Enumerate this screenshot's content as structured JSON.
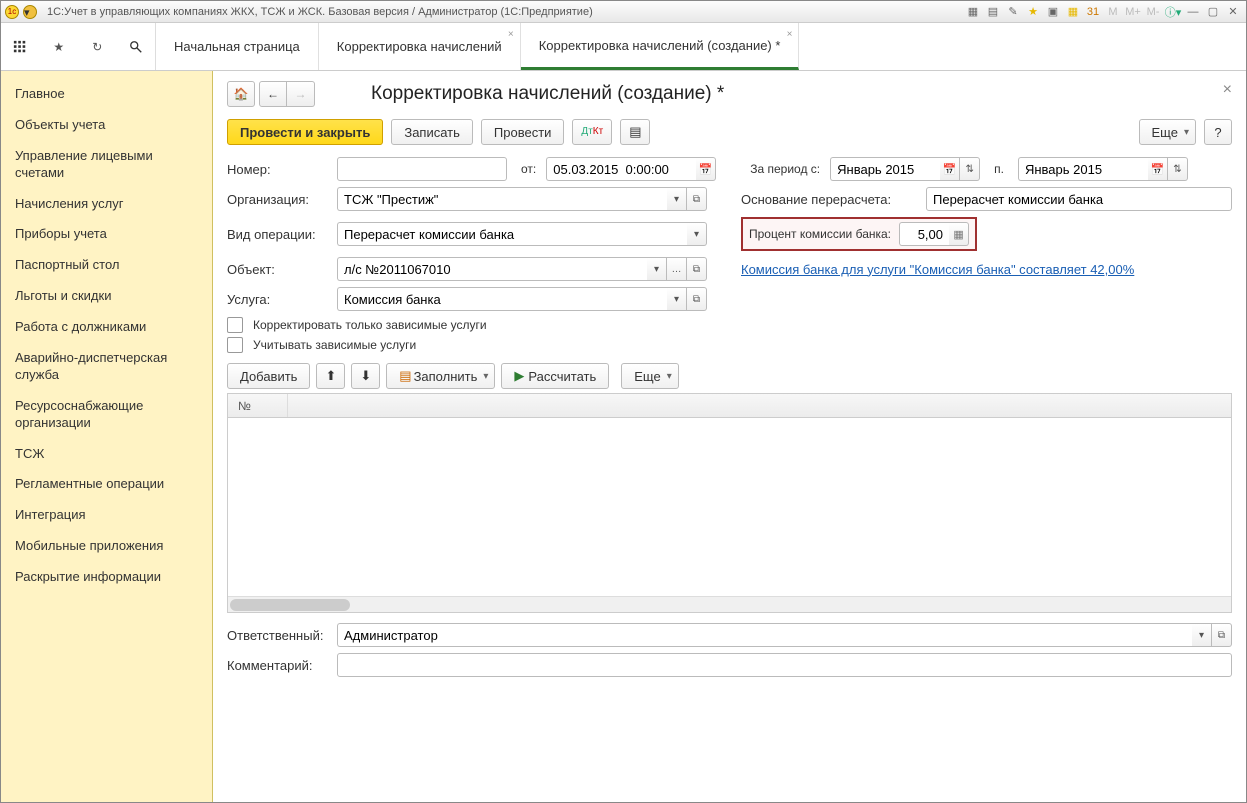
{
  "titlebar": {
    "text": "1С:Учет в управляющих компаниях ЖКХ, ТСЖ и ЖСК. Базовая версия / Администратор  (1С:Предприятие)"
  },
  "tabs": {
    "home": "Начальная страница",
    "t1": "Корректировка начислений",
    "t2": "Корректировка начислений (создание) *"
  },
  "sidebar": {
    "items": [
      "Главное",
      "Объекты учета",
      "Управление лицевыми счетами",
      "Начисления услуг",
      "Приборы учета",
      "Паспортный стол",
      "Льготы и скидки",
      "Работа с должниками",
      "Аварийно-диспетчерская служба",
      "Ресурсоснабжающие организации",
      "ТСЖ",
      "Регламентные операции",
      "Интеграция",
      "Мобильные приложения",
      "Раскрытие информации"
    ]
  },
  "page": {
    "title": "Корректировка начислений (создание) *",
    "toolbar": {
      "post_close": "Провести и закрыть",
      "write": "Записать",
      "post": "Провести",
      "more": "Еще",
      "help": "?"
    },
    "labels": {
      "number": "Номер:",
      "from": "от:",
      "period_from": "За период с:",
      "period_to": "п.",
      "org": "Организация:",
      "basis": "Основание перерасчета:",
      "op_type": "Вид операции:",
      "percent": "Процент комиссии банка:",
      "object": "Объект:",
      "service": "Услуга:",
      "correct_dep": "Корректировать только зависимые услуги",
      "account_dep": "Учитывать зависимые услуги",
      "responsible": "Ответственный:",
      "comment": "Комментарий:"
    },
    "values": {
      "number": "",
      "date": "05.03.2015  0:00:00",
      "period_from": "Январь 2015",
      "period_to": "Январь 2015",
      "org": "ТСЖ \"Престиж\"",
      "basis": "Перерасчет комиссии банка",
      "op_type": "Перерасчет комиссии банка",
      "percent": "5,00",
      "object": "л/с №2011067010",
      "service": "Комиссия банка",
      "responsible": "Администратор",
      "comment": ""
    },
    "link_text": "Комиссия банка для услуги \"Комиссия банка\" составляет 42,00%",
    "subtoolbar": {
      "add": "Добавить",
      "fill": "Заполнить",
      "calc": "Рассчитать",
      "more": "Еще"
    },
    "table": {
      "col1": "№"
    }
  }
}
